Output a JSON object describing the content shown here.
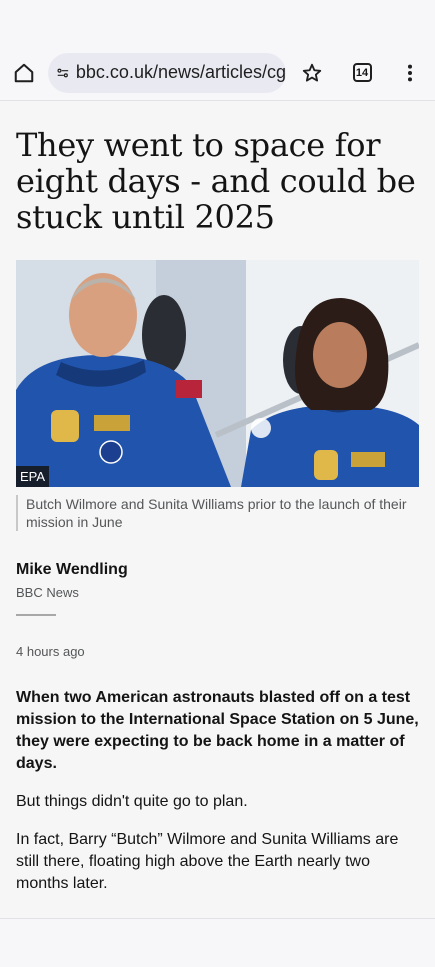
{
  "browser": {
    "url": "bbc.co.uk/news/articles/cg",
    "tab_count": "14",
    "icons": [
      "home-icon",
      "site-settings-icon",
      "star-icon",
      "tabs-icon",
      "more-vert-icon"
    ]
  },
  "article": {
    "headline": "They went to space for eight days - and could be stuck until 2025",
    "image_credit": "EPA",
    "caption": "Butch Wilmore and Sunita Williams prior to the launch of their mission in June",
    "author": "Mike Wendling",
    "publisher": "BBC News",
    "timestamp": "4 hours ago",
    "lead": "When two American astronauts blasted off on a test mission to the International Space Station on 5 June, they were expecting to be back home in a matter of days.",
    "paragraphs": [
      "But things didn't quite go to plan.",
      "In fact, Barry “Butch” Wilmore and Sunita Williams are still there, floating high above the Earth nearly two months later."
    ]
  },
  "colors": {
    "toolbar_bg": "#f7f7fa",
    "page_bg": "#f6f6f6",
    "suit_blue": "#1f57b3"
  }
}
